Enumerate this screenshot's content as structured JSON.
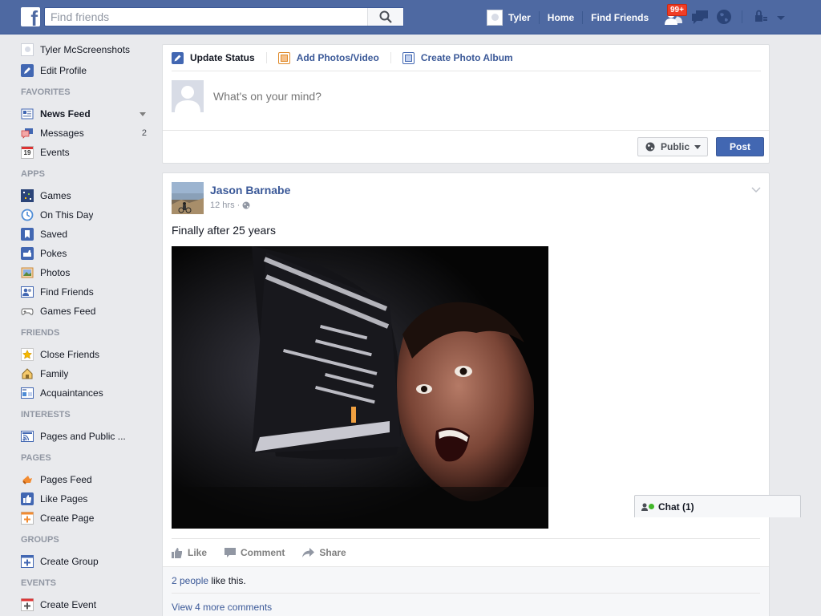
{
  "header": {
    "search_placeholder": "Find friends",
    "user_name": "Tyler",
    "home": "Home",
    "find_friends": "Find Friends",
    "friend_requests_badge": "99+",
    "brand_color": "#4e69a2"
  },
  "sidebar": {
    "profile": {
      "name": "Tyler McScreenshots",
      "edit": "Edit Profile"
    },
    "sections": {
      "favorites": "FAVORITES",
      "apps": "APPS",
      "friends": "FRIENDS",
      "interests": "INTERESTS",
      "pages": "PAGES",
      "groups": "GROUPS",
      "events": "EVENTS"
    },
    "favorites": [
      {
        "label": "News Feed",
        "icon": "news-feed-icon"
      },
      {
        "label": "Messages",
        "count": "2",
        "icon": "messages-icon"
      },
      {
        "label": "Events",
        "icon": "calendar-icon",
        "day": "19"
      }
    ],
    "apps": [
      {
        "label": "Games",
        "icon": "games-icon"
      },
      {
        "label": "On This Day",
        "icon": "on-this-day-icon"
      },
      {
        "label": "Saved",
        "icon": "bookmark-icon"
      },
      {
        "label": "Pokes",
        "icon": "poke-icon"
      },
      {
        "label": "Photos",
        "icon": "photos-icon"
      },
      {
        "label": "Find Friends",
        "icon": "find-friends-icon"
      },
      {
        "label": "Games Feed",
        "icon": "gamepad-icon"
      }
    ],
    "friends": [
      {
        "label": "Close Friends",
        "icon": "star-icon"
      },
      {
        "label": "Family",
        "icon": "house-icon"
      },
      {
        "label": "Acquaintances",
        "icon": "acquaintances-icon"
      }
    ],
    "interests": [
      {
        "label": "Pages and Public ...",
        "icon": "feed-icon"
      }
    ],
    "pages": [
      {
        "label": "Pages Feed",
        "icon": "pages-feed-icon"
      },
      {
        "label": "Like Pages",
        "icon": "thumbs-up-icon"
      },
      {
        "label": "Create Page",
        "icon": "plus-icon"
      }
    ],
    "groups": [
      {
        "label": "Create Group",
        "icon": "plus-icon"
      }
    ],
    "events": [
      {
        "label": "Create Event",
        "icon": "plus-icon"
      }
    ]
  },
  "composer": {
    "tabs": [
      "Update Status",
      "Add Photos/Video",
      "Create Photo Album"
    ],
    "placeholder": "What's on your mind?",
    "privacy": "Public",
    "post": "Post"
  },
  "story": {
    "author": "Jason Barnabe",
    "time": "12 hrs",
    "text": "Finally after 25 years",
    "actions": {
      "like": "Like",
      "comment": "Comment",
      "share": "Share"
    },
    "likes_link": "2 people",
    "likes_suffix": " like this.",
    "more_comments": "View 4 more comments"
  },
  "chat": {
    "label": "Chat (1)"
  }
}
